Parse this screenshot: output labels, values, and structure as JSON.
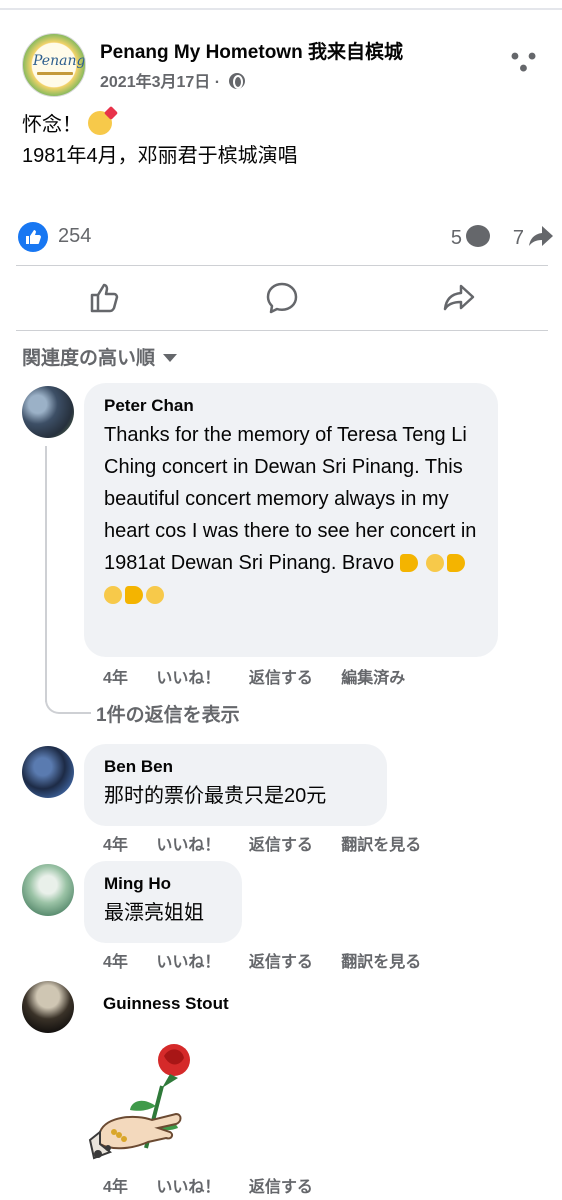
{
  "post": {
    "page_name": "Penang My Hometown 我来自槟城",
    "date": "2021年3月17日 ·",
    "logo_text": "Penang",
    "text_line1": "怀念！",
    "text_line2": "1981年4月，邓丽君于槟城演唱",
    "likes": "254",
    "comments": "5",
    "shares": "7"
  },
  "sort_label": "関連度の高い順",
  "comments": [
    {
      "name": "Peter Chan",
      "text": "Thanks for the memory of Teresa Teng Li Ching concert in Dewan Sri Pinang. This beautiful concert memory always in my heart cos I was there to see her concert in 1981at Dewan Sri Pinang. Bravo",
      "time": "4年",
      "like": "いいね！",
      "reply": "返信する",
      "extra": "編集済み",
      "view_replies": "1件の返信を表示"
    },
    {
      "name": "Ben Ben",
      "text": "那时的票价最贵只是20元",
      "time": "4年",
      "like": "いいね！",
      "reply": "返信する",
      "extra": "翻訳を見る"
    },
    {
      "name": "Ming Ho",
      "text": "最漂亮姐姐",
      "time": "4年",
      "like": "いいね！",
      "reply": "返信する",
      "extra": "翻訳を見る"
    },
    {
      "name": "Guinness Stout",
      "time": "4年",
      "like": "いいね！",
      "reply": "返信する"
    }
  ],
  "colors": {
    "accent": "#1877f2",
    "secondary_text": "#65676b",
    "bubble_bg": "#f0f2f5"
  }
}
